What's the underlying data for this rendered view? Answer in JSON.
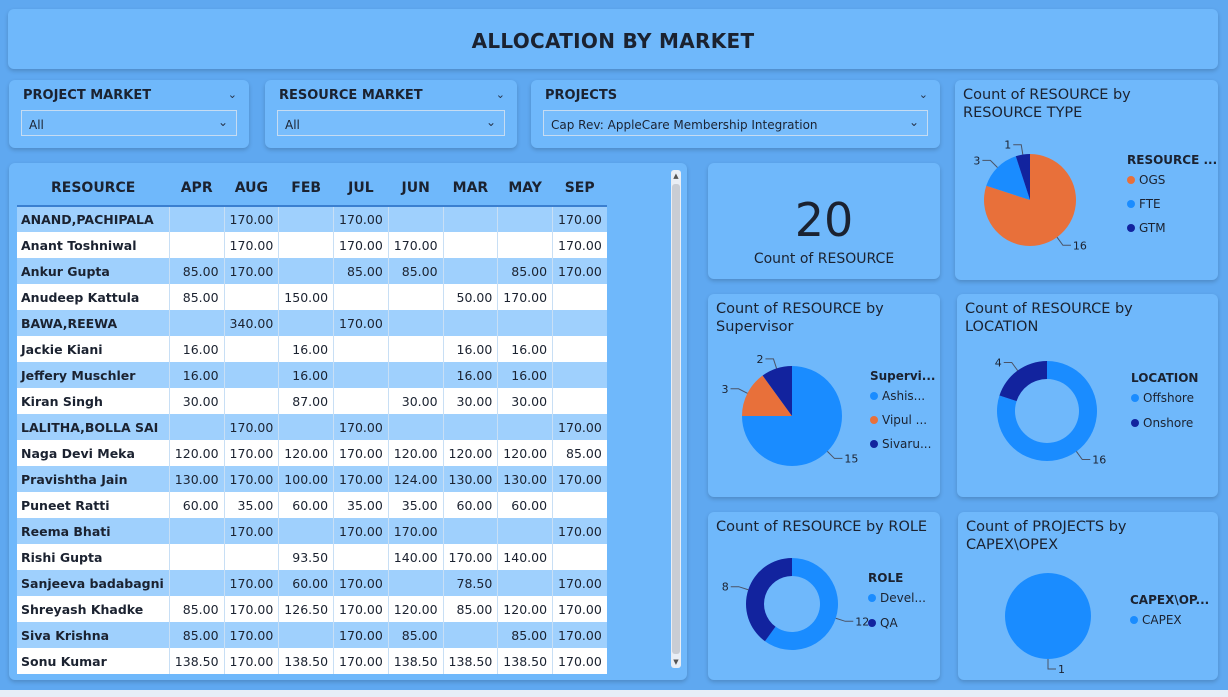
{
  "title": "ALLOCATION BY MARKET",
  "slicers": [
    {
      "id": "project",
      "label": "PROJECT MARKET",
      "value": "All"
    },
    {
      "id": "resource",
      "label": "RESOURCE MARKET",
      "value": "All"
    },
    {
      "id": "projects",
      "label": "PROJECTS",
      "value": "Cap Rev: AppleCare Membership Integration"
    }
  ],
  "table": {
    "headers": [
      "RESOURCE",
      "APR",
      "AUG",
      "FEB",
      "JUL",
      "JUN",
      "MAR",
      "MAY",
      "SEP"
    ],
    "rows": [
      [
        "ANAND,PACHIPALA",
        "",
        "170.00",
        "",
        "170.00",
        "",
        "",
        "",
        "170.00"
      ],
      [
        "Anant Toshniwal",
        "",
        "170.00",
        "",
        "170.00",
        "170.00",
        "",
        "",
        "170.00"
      ],
      [
        "Ankur Gupta",
        "85.00",
        "170.00",
        "",
        "85.00",
        "85.00",
        "",
        "85.00",
        "170.00"
      ],
      [
        "Anudeep Kattula",
        "85.00",
        "",
        "150.00",
        "",
        "",
        "50.00",
        "170.00",
        ""
      ],
      [
        "BAWA,REEWA",
        "",
        "340.00",
        "",
        "170.00",
        "",
        "",
        "",
        ""
      ],
      [
        "Jackie Kiani",
        "16.00",
        "",
        "16.00",
        "",
        "",
        "16.00",
        "16.00",
        ""
      ],
      [
        "Jeffery Muschler",
        "16.00",
        "",
        "16.00",
        "",
        "",
        "16.00",
        "16.00",
        ""
      ],
      [
        "Kiran Singh",
        "30.00",
        "",
        "87.00",
        "",
        "30.00",
        "30.00",
        "30.00",
        ""
      ],
      [
        "LALITHA,BOLLA SAI",
        "",
        "170.00",
        "",
        "170.00",
        "",
        "",
        "",
        "170.00"
      ],
      [
        "Naga Devi Meka",
        "120.00",
        "170.00",
        "120.00",
        "170.00",
        "120.00",
        "120.00",
        "120.00",
        "85.00"
      ],
      [
        "Pravishtha Jain",
        "130.00",
        "170.00",
        "100.00",
        "170.00",
        "124.00",
        "130.00",
        "130.00",
        "170.00"
      ],
      [
        "Puneet Ratti",
        "60.00",
        "35.00",
        "60.00",
        "35.00",
        "35.00",
        "60.00",
        "60.00",
        ""
      ],
      [
        "Reema Bhati",
        "",
        "170.00",
        "",
        "170.00",
        "170.00",
        "",
        "",
        "170.00"
      ],
      [
        "Rishi Gupta",
        "",
        "",
        "93.50",
        "",
        "140.00",
        "170.00",
        "140.00",
        ""
      ],
      [
        "Sanjeeva badabagni",
        "",
        "170.00",
        "60.00",
        "170.00",
        "",
        "78.50",
        "",
        "170.00"
      ],
      [
        "Shreyash Khadke",
        "85.00",
        "170.00",
        "126.50",
        "170.00",
        "120.00",
        "85.00",
        "120.00",
        "170.00"
      ],
      [
        "Siva Krishna",
        "85.00",
        "170.00",
        "",
        "170.00",
        "85.00",
        "",
        "85.00",
        "170.00"
      ],
      [
        "Sonu Kumar",
        "138.50",
        "170.00",
        "138.50",
        "170.00",
        "138.50",
        "138.50",
        "138.50",
        "170.00"
      ]
    ]
  },
  "kpi": {
    "value": "20",
    "label": "Count of RESOURCE"
  },
  "colors": {
    "orange": "#e8703a",
    "blue": "#1a8cff",
    "navy": "#12239e"
  },
  "chart_data": [
    {
      "id": "type",
      "type": "pie",
      "title": "Count of RESOURCE by RESOURCE TYPE",
      "legend_title": "RESOURCE ...",
      "categories": [
        "OGS",
        "FTE",
        "GTM"
      ],
      "values": [
        16,
        3,
        1
      ],
      "labels": [
        "16",
        "3",
        "1"
      ],
      "colors": [
        "#e8703a",
        "#1a8cff",
        "#12239e"
      ]
    },
    {
      "id": "super",
      "type": "pie",
      "title": "Count of RESOURCE by Supervisor",
      "legend_title": "Supervi...",
      "categories": [
        "Ashis...",
        "Vipul ...",
        "Sivaru..."
      ],
      "values": [
        15,
        3,
        2
      ],
      "labels": [
        "15",
        "3",
        "2"
      ],
      "colors": [
        "#1a8cff",
        "#e8703a",
        "#12239e"
      ]
    },
    {
      "id": "loc",
      "type": "donut",
      "title": "Count of RESOURCE by LOCATION",
      "legend_title": "LOCATION",
      "categories": [
        "Offshore",
        "Onshore"
      ],
      "values": [
        16,
        4
      ],
      "labels": [
        "16",
        "4"
      ],
      "colors": [
        "#1a8cff",
        "#12239e"
      ]
    },
    {
      "id": "role",
      "type": "donut",
      "title": "Count of RESOURCE by ROLE",
      "legend_title": "ROLE",
      "categories": [
        "Devel...",
        "QA"
      ],
      "values": [
        12,
        8
      ],
      "labels": [
        "12",
        "8"
      ],
      "colors": [
        "#1a8cff",
        "#12239e"
      ]
    },
    {
      "id": "capex",
      "type": "pie",
      "title": "Count of PROJECTS by CAPEX\\OPEX",
      "legend_title": "CAPEX\\OP...",
      "categories": [
        "CAPEX"
      ],
      "values": [
        1
      ],
      "labels": [
        "1"
      ],
      "colors": [
        "#1a8cff"
      ]
    }
  ]
}
